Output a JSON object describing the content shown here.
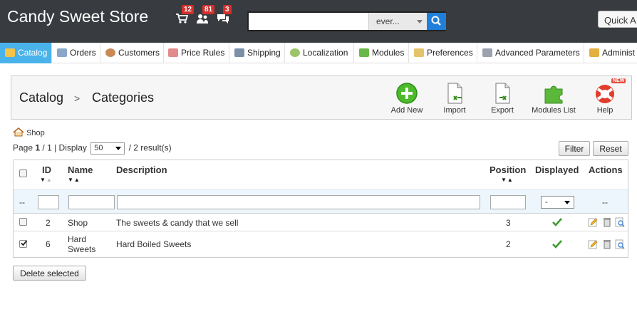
{
  "header": {
    "shop_name": "Candy Sweet Store",
    "notifications": {
      "orders": "12",
      "customers": "81",
      "messages": "3"
    },
    "search": {
      "value": "",
      "scope": "ever..."
    },
    "quick_access": "Quick A"
  },
  "nav": {
    "items": [
      {
        "label": "Catalog"
      },
      {
        "label": "Orders"
      },
      {
        "label": "Customers"
      },
      {
        "label": "Price Rules"
      },
      {
        "label": "Shipping"
      },
      {
        "label": "Localization"
      },
      {
        "label": "Modules"
      },
      {
        "label": "Preferences"
      },
      {
        "label": "Advanced Parameters"
      },
      {
        "label": "Administ"
      }
    ]
  },
  "toolbar": {
    "breadcrumb": {
      "section": "Catalog",
      "separator": ">",
      "page": "Categories"
    },
    "buttons": {
      "add_new": "Add New",
      "import": "Import",
      "export": "Export",
      "modules_list": "Modules List",
      "help": "Help",
      "help_badge": "NEW"
    }
  },
  "crumb": {
    "shop": "Shop"
  },
  "pager": {
    "page_label": "Page",
    "current": "1",
    "total": "/ 1",
    "display_label": "| Display",
    "per_page": "50",
    "results": "/ 2 result(s)"
  },
  "actions": {
    "filter": "Filter",
    "reset": "Reset",
    "delete_selected": "Delete selected"
  },
  "table": {
    "columns": {
      "id": "ID",
      "name": "Name",
      "description": "Description",
      "position": "Position",
      "displayed": "Displayed",
      "actions": "Actions"
    },
    "filter": {
      "dash": "--",
      "displayed_select": "-",
      "actions_dash": "--"
    },
    "rows": [
      {
        "id": "2",
        "name": "Shop",
        "description": "The sweets & candy that we sell",
        "position": "3",
        "checked": false
      },
      {
        "id": "6",
        "name": "Hard Sweets",
        "description": "Hard Boiled Sweets",
        "position": "2",
        "checked": true
      }
    ]
  },
  "colors": {
    "header_bg": "#383b40",
    "active_tab": "#49b2ea",
    "search_button": "#1f7fdb",
    "badge": "#d0312d",
    "check_green": "#3d9a2d"
  }
}
